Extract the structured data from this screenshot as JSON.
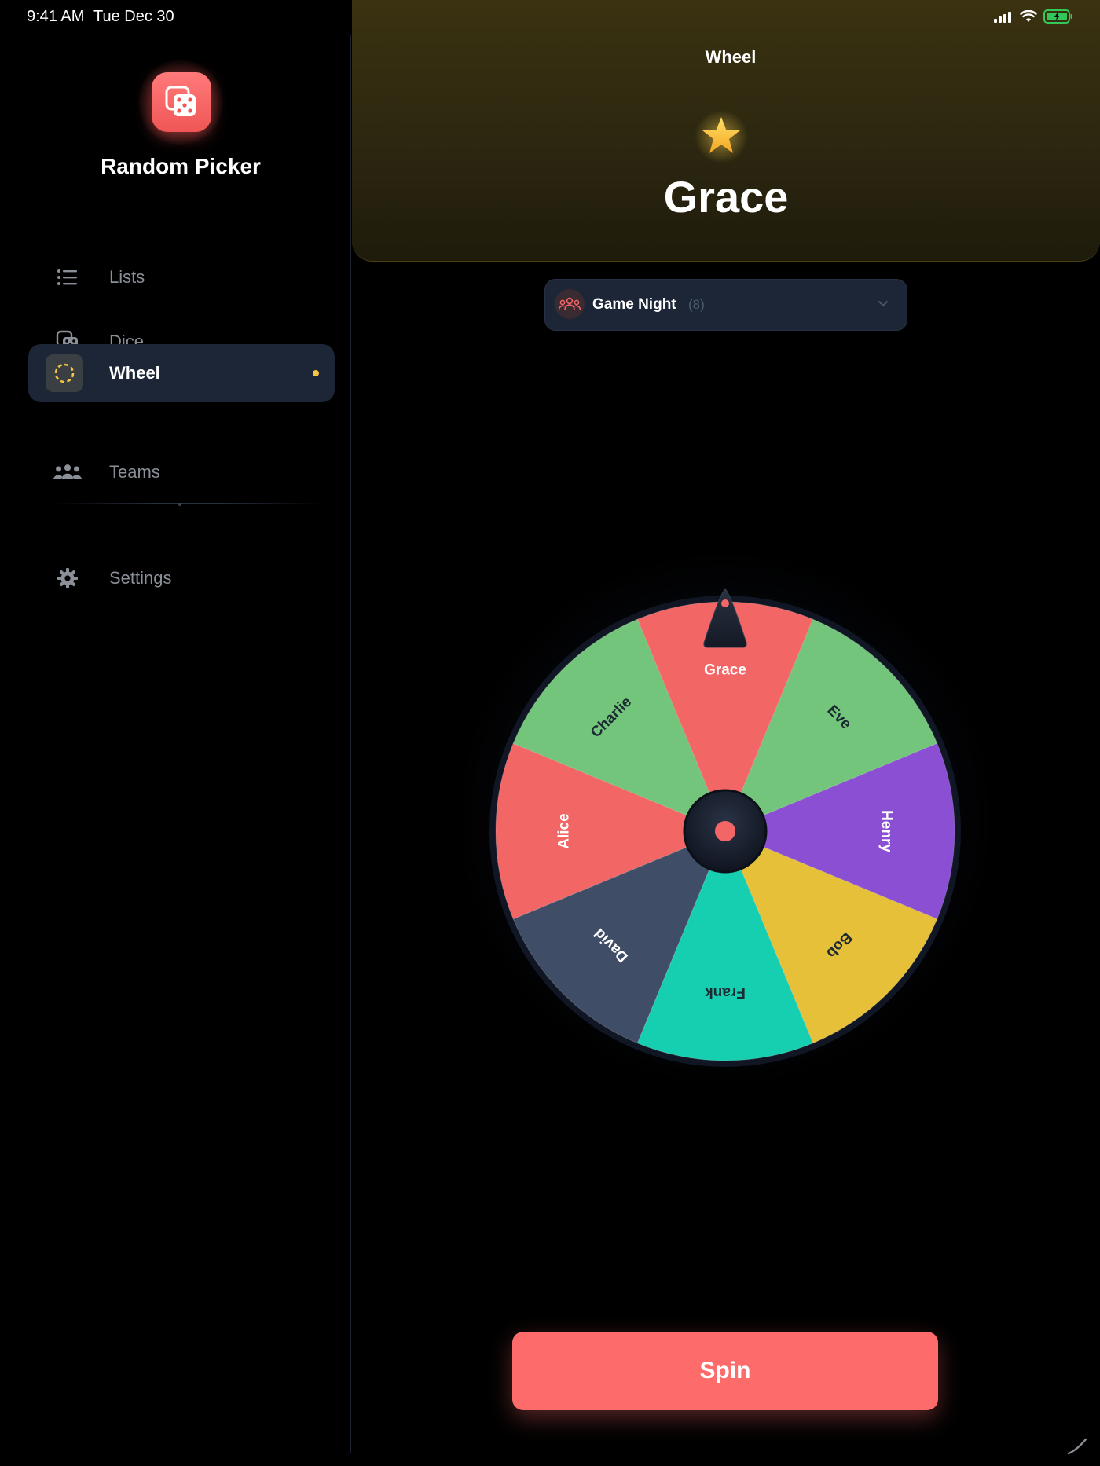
{
  "status_bar": {
    "time": "9:41 AM",
    "date": "Tue Dec 30"
  },
  "sidebar": {
    "app_title": "Random Picker",
    "items": [
      {
        "label": "Lists",
        "icon": "list-icon",
        "active": false
      },
      {
        "label": "Dice",
        "icon": "dice-icon",
        "active": false
      },
      {
        "label": "Wheel",
        "icon": "wheel-icon",
        "active": true
      },
      {
        "label": "Teams",
        "icon": "people-icon",
        "active": false
      },
      {
        "label": "Settings",
        "icon": "gear-icon",
        "active": false
      }
    ]
  },
  "header": {
    "title": "Wheel",
    "winner": "Grace"
  },
  "selector": {
    "label": "Game Night",
    "count": "(8)"
  },
  "wheel": {
    "segments": [
      {
        "name": "Grace",
        "color": "#f26666"
      },
      {
        "name": "Eve",
        "color": "#72c57a"
      },
      {
        "name": "Henry",
        "color": "#8a4fd3"
      },
      {
        "name": "Bob",
        "color": "#e6c038"
      },
      {
        "name": "Frank",
        "color": "#16cfb0"
      },
      {
        "name": "David",
        "color": "#3f4e66"
      },
      {
        "name": "Alice",
        "color": "#f26666"
      },
      {
        "name": "Charlie",
        "color": "#72c57a"
      }
    ]
  },
  "spin_button": {
    "label": "Spin"
  },
  "colors": {
    "accent": "#fd6b6b",
    "active_dot": "#f5c542"
  }
}
